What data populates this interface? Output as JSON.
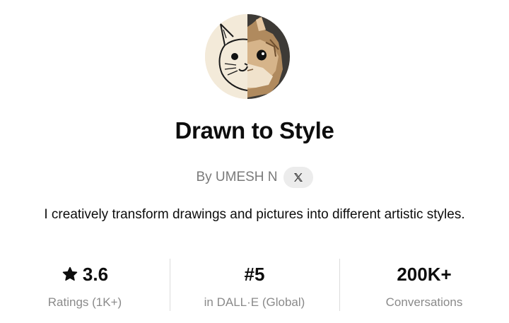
{
  "gpt": {
    "name": "Drawn to Style",
    "author": "By UMESH N",
    "social_icon": "x-logo-icon",
    "description": "I creatively transform drawings and pictures into different artistic styles."
  },
  "stats": [
    {
      "icon": "star-icon",
      "value": "3.6",
      "label": "Ratings (1K+)"
    },
    {
      "value": "#5",
      "label": "in DALL·E (Global)"
    },
    {
      "value": "200K+",
      "label": "Conversations"
    }
  ],
  "colors": {
    "text": "#0d0d0d",
    "muted": "#8a8a8a",
    "badge_bg": "#ececec",
    "divider": "#dcdcdc"
  }
}
